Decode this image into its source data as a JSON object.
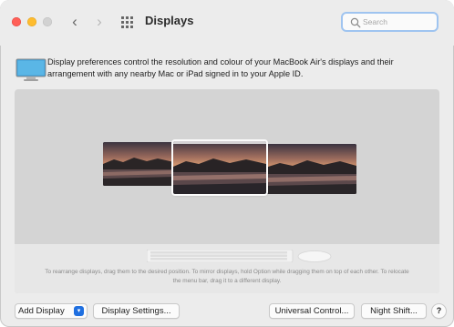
{
  "window": {
    "title": "Displays",
    "search_placeholder": "Search"
  },
  "description": "Display preferences control the resolution and colour of your MacBook Air's displays and their arrangement with any nearby Mac or iPad signed in to your Apple ID.",
  "arrangement": {
    "hint": "To rearrange displays, drag them to the desired position. To mirror displays, hold Option while dragging them on top of each other. To relocate the menu bar, drag it to a different display."
  },
  "buttons": {
    "add_display": "Add Display",
    "display_settings": "Display Settings...",
    "universal_control": "Universal Control...",
    "night_shift": "Night Shift...",
    "help": "?"
  },
  "colors": {
    "close": "#ff5f57",
    "minimize": "#febc2e",
    "accent": "#1f6fe0"
  }
}
